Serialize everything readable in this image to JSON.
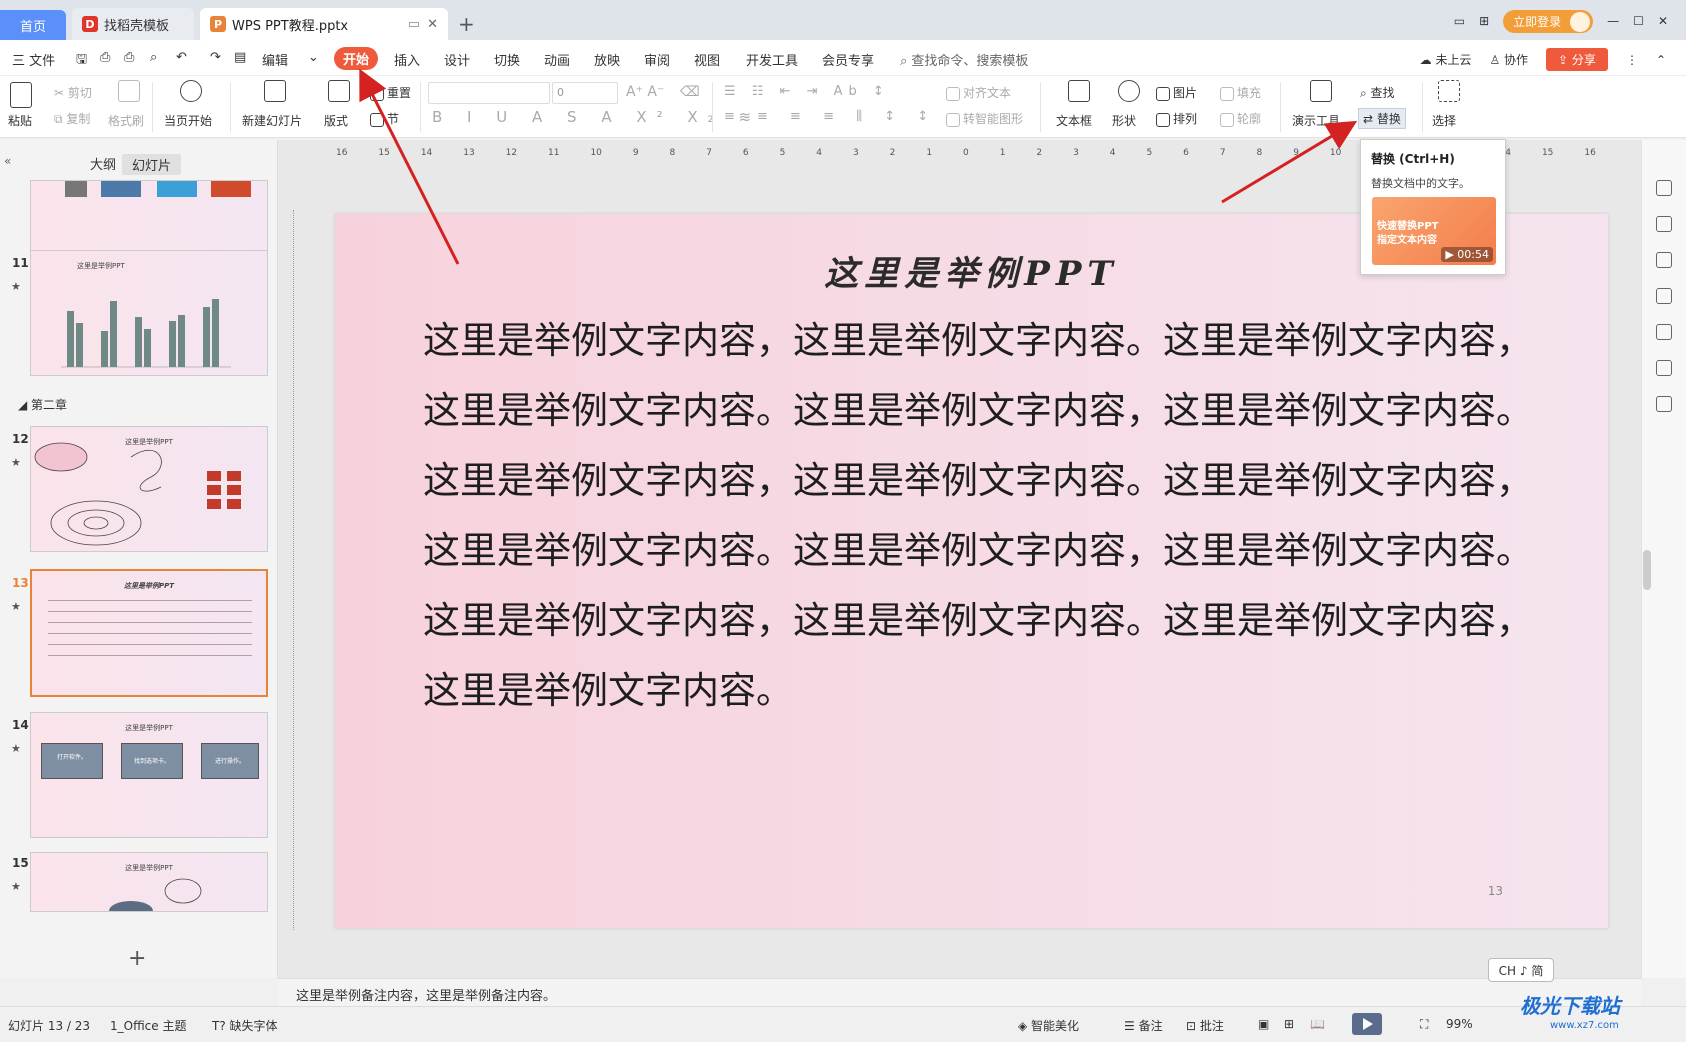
{
  "tabs": {
    "home": "首页",
    "template": "找稻壳模板",
    "doc": "WPS PPT教程.pptx",
    "add": "+"
  },
  "window": {
    "login": "立即登录"
  },
  "menu": {
    "file": "三 文件",
    "edit": "编辑",
    "start": "开始",
    "insert": "插入",
    "design": "设计",
    "transition": "切换",
    "animation": "动画",
    "slideshow": "放映",
    "review": "审阅",
    "view": "视图",
    "devtools": "开发工具",
    "vip": "会员专享",
    "search": "查找命令、搜索模板",
    "cloud": "未上云",
    "collab": "协作",
    "share": "分享"
  },
  "ribbon": {
    "paste": "粘贴",
    "cut": "剪切",
    "copy": "复制",
    "format_painter": "格式刷",
    "from_current": "当页开始",
    "new_slide": "新建幻灯片",
    "layout": "版式",
    "reset": "重置",
    "section": "节",
    "font_size": "0",
    "align_text": "对齐文本",
    "smart_shape": "转智能图形",
    "textbox": "文本框",
    "shape": "形状",
    "picture": "图片",
    "arrange": "排列",
    "fill": "填充",
    "outline": "轮廓",
    "present_tools": "演示工具",
    "find": "查找",
    "replace": "替换",
    "select": "选择"
  },
  "tooltip": {
    "title": "替换 (Ctrl+H)",
    "desc": "替换文档中的文字。",
    "video_line1": "快速替换PPT",
    "video_line2": "指定文本内容",
    "duration": "00:54"
  },
  "panel": {
    "outline_tab": "大纲",
    "slides_tab": "幻灯片",
    "chapter": "第二章",
    "slides": [
      {
        "num": "11",
        "title": "这里是举例PPT"
      },
      {
        "num": "12",
        "title": "这里是举例PPT"
      },
      {
        "num": "13",
        "title": "这里是举例PPT"
      },
      {
        "num": "14",
        "title": "这里是举例PPT",
        "boxes": [
          "打开软件。",
          "找到选项卡。",
          "进行操作。"
        ]
      },
      {
        "num": "15",
        "title": "这里是举例PPT"
      }
    ],
    "add": "+"
  },
  "slide": {
    "title": "这里是举例PPT",
    "body": "这里是举例文字内容，这里是举例文字内容。这里是举例文字内容，这里是举例文字内容。这里是举例文字内容，这里是举例文字内容。 这里是举例文字内容，这里是举例文字内容。这里是举例文字内容，这里是举例文字内容。这里是举例文字内容，这里是举例文字内容。这里是举例文字内容，这里是举例文字内容。这里是举例文字内容，这里是举例文字内容。",
    "number": "13"
  },
  "ruler": [
    "16",
    "15",
    "14",
    "13",
    "12",
    "11",
    "10",
    "9",
    "8",
    "7",
    "6",
    "5",
    "4",
    "3",
    "2",
    "1",
    "0",
    "1",
    "2",
    "3",
    "4",
    "5",
    "6",
    "7",
    "8",
    "9",
    "10",
    "11",
    "12",
    "13",
    "14",
    "15",
    "16"
  ],
  "notes": "这里是举例备注内容，这里是举例备注内容。",
  "ime": "CH ♪ 简",
  "status": {
    "slide_counter": "幻灯片 13 / 23",
    "theme": "1_Office 主题",
    "missing_font": "缺失字体",
    "beautify": "智能美化",
    "notes": "备注",
    "comments": "批注",
    "zoom": "99%"
  },
  "watermark": {
    "main": "极光下载站",
    "sub": "www.xz7.com"
  }
}
